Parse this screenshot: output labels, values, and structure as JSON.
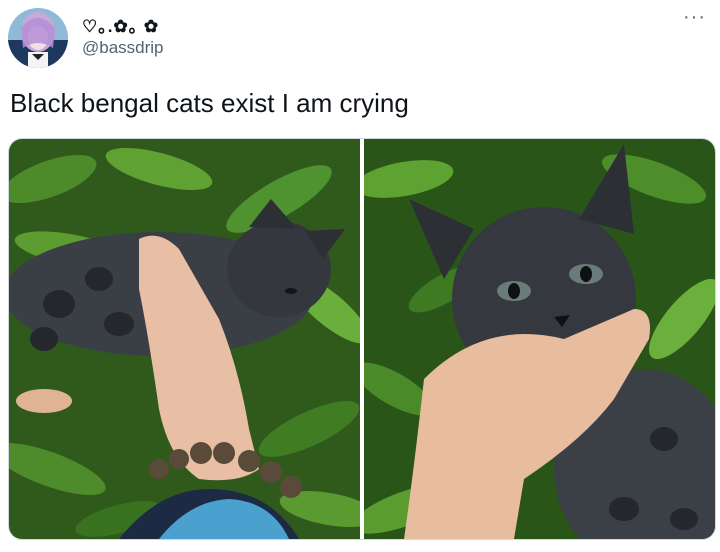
{
  "tweet": {
    "display_name": "♡｡.✿｡ ✿",
    "handle": "@bassdrip",
    "text": "Black bengal cats exist I am crying",
    "more_label": "···"
  },
  "colors": {
    "text_primary": "#0f1419",
    "text_secondary": "#536471",
    "border": "#cfd9de"
  },
  "icons": {
    "more": "more-horizontal-icon"
  }
}
